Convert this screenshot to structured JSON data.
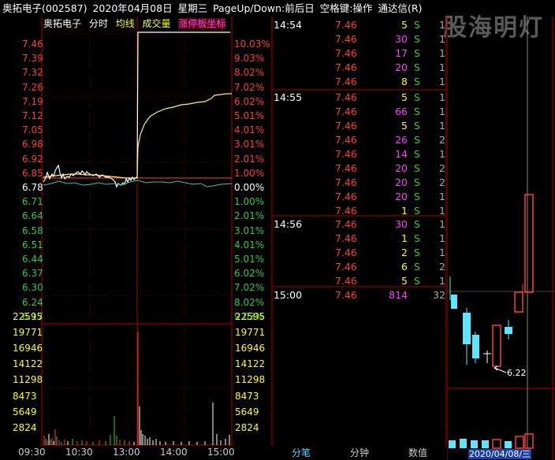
{
  "header": {
    "stock": "奥拓电子(002587)",
    "date": "2020年04月08日",
    "weekday": "星期三",
    "nav_hint": "PageUp/Down:前后日",
    "space_hint": "空格键:操作",
    "app": "通达信(R)"
  },
  "watermark": "股海明灯",
  "legend": {
    "name": "奥拓电子",
    "mode": "分时",
    "avg": "均线",
    "volume": "成交量",
    "limit": "涨停板坐标"
  },
  "price_axis": [
    "7.46",
    "7.39",
    "7.32",
    "7.26",
    "7.19",
    "7.12",
    "7.05",
    "6.98",
    "6.92",
    "6.85",
    "6.78",
    "6.71",
    "6.64",
    "6.58",
    "6.51",
    "6.44",
    "6.37",
    "6.30",
    "6.24",
    "6.17"
  ],
  "pct_axis": [
    "10.03%",
    "9.03%",
    "8.02%",
    "7.02%",
    "6.02%",
    "5.01%",
    "4.01%",
    "3.01%",
    "2.01%",
    "1.00%",
    "0.00%",
    "1.00%",
    "2.01%",
    "3.01%",
    "4.01%",
    "5.01%",
    "6.02%",
    "7.02%",
    "8.02%",
    "9.03%"
  ],
  "volume_axis": [
    "22595",
    "19771",
    "16946",
    "14122",
    "11298",
    "8473",
    "5649",
    "2824"
  ],
  "time_axis": [
    "09:30",
    "10:30",
    "13:00",
    "14:00",
    "15:00"
  ],
  "colors": {
    "up": "#ff3b3b",
    "down": "#2ecc40",
    "neutral": "#ffffff",
    "volume_label": "#ffff00",
    "accent": "#ff3cff"
  },
  "trades": [
    {
      "time": "14:54",
      "price": "7.46",
      "vol": "5",
      "bs": "S",
      "cnt": "1",
      "color": "yellow"
    },
    {
      "time": "",
      "price": "7.46",
      "vol": "30",
      "bs": "S",
      "cnt": "1",
      "color": "magenta"
    },
    {
      "time": "",
      "price": "7.46",
      "vol": "17",
      "bs": "S",
      "cnt": "1",
      "color": "magenta"
    },
    {
      "time": "",
      "price": "7.46",
      "vol": "20",
      "bs": "S",
      "cnt": "1",
      "color": "magenta"
    },
    {
      "time": "",
      "price": "7.46",
      "vol": "8",
      "bs": "S",
      "cnt": "1",
      "color": "yellow"
    },
    {
      "time": "14:55",
      "price": "7.46",
      "vol": "5",
      "bs": "S",
      "cnt": "1",
      "color": "yellow"
    },
    {
      "time": "",
      "price": "7.46",
      "vol": "66",
      "bs": "S",
      "cnt": "1",
      "color": "magenta"
    },
    {
      "time": "",
      "price": "7.46",
      "vol": "5",
      "bs": "S",
      "cnt": "1",
      "color": "yellow"
    },
    {
      "time": "",
      "price": "7.46",
      "vol": "26",
      "bs": "S",
      "cnt": "2",
      "color": "magenta"
    },
    {
      "time": "",
      "price": "7.46",
      "vol": "14",
      "bs": "S",
      "cnt": "1",
      "color": "magenta"
    },
    {
      "time": "",
      "price": "7.46",
      "vol": "20",
      "bs": "S",
      "cnt": "2",
      "color": "magenta"
    },
    {
      "time": "",
      "price": "7.46",
      "vol": "20",
      "bs": "S",
      "cnt": "2",
      "color": "magenta"
    },
    {
      "time": "",
      "price": "7.46",
      "vol": "20",
      "bs": "S",
      "cnt": "1",
      "color": "magenta"
    },
    {
      "time": "",
      "price": "7.46",
      "vol": "1",
      "bs": "S",
      "cnt": "1",
      "color": "yellow"
    },
    {
      "time": "14:56",
      "price": "7.46",
      "vol": "30",
      "bs": "S",
      "cnt": "1",
      "color": "magenta"
    },
    {
      "time": "",
      "price": "7.46",
      "vol": "1",
      "bs": "S",
      "cnt": "1",
      "color": "yellow"
    },
    {
      "time": "",
      "price": "7.46",
      "vol": "2",
      "bs": "S",
      "cnt": "1",
      "color": "yellow"
    },
    {
      "time": "",
      "price": "7.46",
      "vol": "6",
      "bs": "S",
      "cnt": "2",
      "color": "yellow"
    },
    {
      "time": "",
      "price": "7.46",
      "vol": "5",
      "bs": "S",
      "cnt": "1",
      "color": "yellow"
    },
    {
      "time": "15:00",
      "price": "7.46",
      "vol": "814",
      "bs": "",
      "cnt": "32",
      "color": "magenta"
    }
  ],
  "tabs": [
    "分笔",
    "分钟",
    "数值"
  ],
  "mini_chart": {
    "price_label": "6.22",
    "date_label": "2020/04/08/三"
  }
}
